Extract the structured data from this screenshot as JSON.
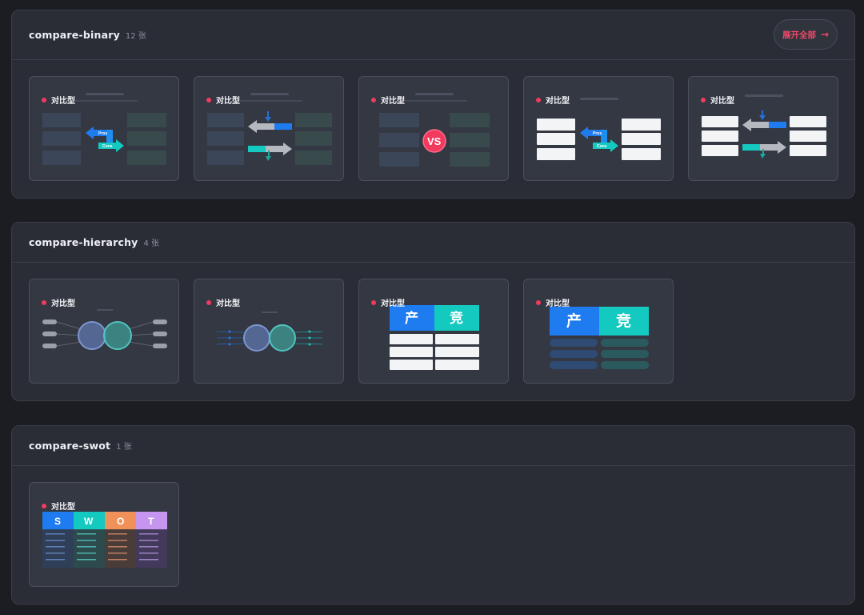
{
  "sections": [
    {
      "title": "compare-binary",
      "count": "12 张",
      "expand_label": "展开全部",
      "card_label": "对比型"
    },
    {
      "title": "compare-hierarchy",
      "count": "4 张",
      "card_label": "对比型"
    },
    {
      "title": "compare-swot",
      "count": "1 张",
      "card_label": "对比型"
    }
  ],
  "thumbs": {
    "pros": "Pros",
    "cons": "Cons",
    "vs": "VS",
    "chan": "产",
    "jing": "竞",
    "swot": [
      "S",
      "W",
      "O",
      "T"
    ]
  },
  "colors": {
    "accent": "#f23a5e",
    "blue": "#1e7bf0",
    "cyan": "#14c9c0"
  },
  "icons": {
    "expand": "arrow-right-icon",
    "card_dot": "red-dot-icon"
  }
}
